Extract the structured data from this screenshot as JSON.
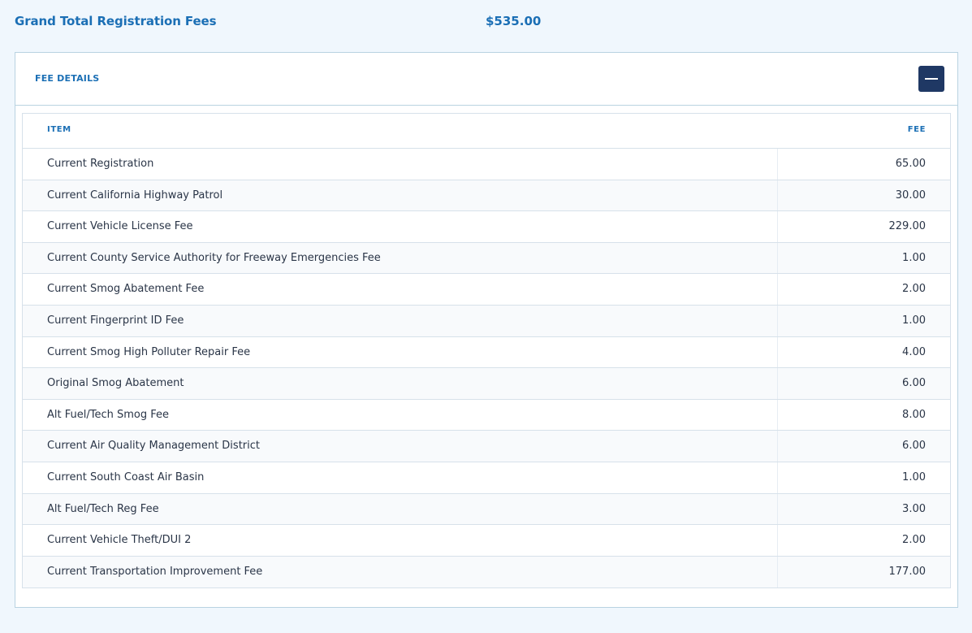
{
  "summary": {
    "label": "Grand Total Registration Fees",
    "value": "$535.00"
  },
  "panel": {
    "title": "FEE DETAILS",
    "collapse_icon": "minus-icon",
    "button_color": "#1f3864"
  },
  "table": {
    "headers": {
      "item": "ITEM",
      "fee": "FEE"
    },
    "rows": [
      {
        "item": "Current Registration",
        "fee": "65.00"
      },
      {
        "item": "Current California Highway Patrol",
        "fee": "30.00"
      },
      {
        "item": "Current Vehicle License Fee",
        "fee": "229.00"
      },
      {
        "item": "Current County Service Authority for Freeway Emergencies Fee",
        "fee": "1.00"
      },
      {
        "item": "Current Smog Abatement Fee",
        "fee": "2.00"
      },
      {
        "item": "Current Fingerprint ID Fee",
        "fee": "1.00"
      },
      {
        "item": "Current Smog High Polluter Repair Fee",
        "fee": "4.00"
      },
      {
        "item": "Original Smog Abatement",
        "fee": "6.00"
      },
      {
        "item": "Alt Fuel/Tech Smog Fee",
        "fee": "8.00"
      },
      {
        "item": "Current Air Quality Management District",
        "fee": "6.00"
      },
      {
        "item": "Current South Coast Air Basin",
        "fee": "1.00"
      },
      {
        "item": "Alt Fuel/Tech Reg Fee",
        "fee": "3.00"
      },
      {
        "item": "Current Vehicle Theft/DUI 2",
        "fee": "2.00"
      },
      {
        "item": "Current Transportation Improvement Fee",
        "fee": "177.00"
      }
    ]
  },
  "colors": {
    "accent": "#1b6fb5",
    "background": "#f0f7fd"
  }
}
